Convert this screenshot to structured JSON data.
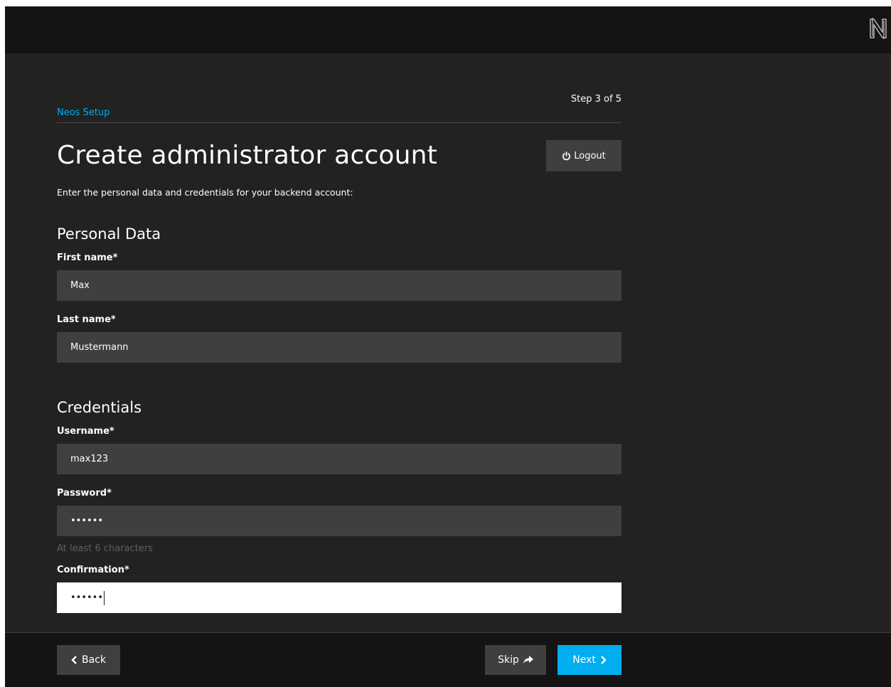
{
  "header": {
    "setup_link": "Neos Setup",
    "step": "Step 3 of 5",
    "title": "Create administrator account",
    "logout_label": "Logout",
    "intro": "Enter the personal data and credentials for your backend account:"
  },
  "personal": {
    "title": "Personal Data",
    "first_name_label": "First name*",
    "first_name_value": "Max",
    "last_name_label": "Last name*",
    "last_name_value": "Mustermann"
  },
  "credentials": {
    "title": "Credentials",
    "username_label": "Username*",
    "username_value": "max123",
    "password_label": "Password*",
    "password_value": "••••••",
    "password_hint": "At least 6 characters",
    "confirmation_label": "Confirmation*",
    "confirmation_value": "••••••"
  },
  "footer": {
    "back_label": "Back",
    "skip_label": "Skip",
    "next_label": "Next"
  },
  "colors": {
    "accent": "#00adee",
    "background": "#222222",
    "topbar": "#141414",
    "field": "#3f3f3f"
  }
}
